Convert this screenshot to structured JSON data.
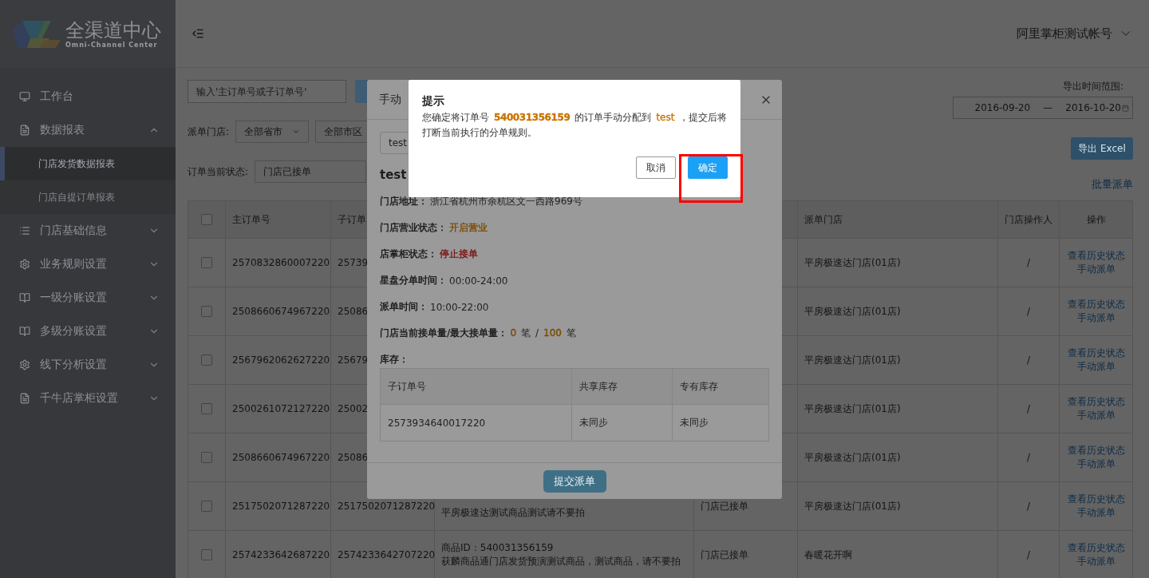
{
  "logo": {
    "title": "全渠道中心",
    "subtitle": "Omni-Channel Center"
  },
  "sidebar": {
    "items": [
      {
        "label": "工作台"
      },
      {
        "label": "数据报表",
        "expanded": true,
        "children": [
          {
            "label": "门店发货数据报表",
            "selected": true
          },
          {
            "label": "门店自提订单报表",
            "selected": false
          }
        ]
      },
      {
        "label": "门店基础信息",
        "expanded": false
      },
      {
        "label": "业务规则设置",
        "expanded": false
      },
      {
        "label": "一级分账设置",
        "expanded": false
      },
      {
        "label": "多级分账设置",
        "expanded": false
      },
      {
        "label": "线下分析设置",
        "expanded": false
      },
      {
        "label": "千牛店掌柜设置",
        "expanded": false
      }
    ]
  },
  "header": {
    "account": "阿里掌柜测试帐号"
  },
  "filters": {
    "search_placeholder": "输入'主订单号或子订单号'",
    "store_label": "派单门店:",
    "province": "全部省市",
    "district": "全部市区",
    "status_label": "订单当前状态:",
    "status": "门店已接单"
  },
  "export": {
    "range_label": "导出时间范围:",
    "start": "2016-09-20",
    "separator": "—",
    "end": "2016-10-20",
    "button": "导出 Excel",
    "batch_link": "批量派单"
  },
  "table": {
    "select_all_checked": false,
    "columns": {
      "main_order": "主订单号",
      "sub_order": "子订单",
      "store": "派单门店",
      "operator": "门店操作人",
      "actions": "操作"
    },
    "rows": [
      {
        "checked": false,
        "main_order": "2570832860007220",
        "sub_order": "25739",
        "store": "平房极速达门店(01店)",
        "operator": "/",
        "actions": [
          "查看历史状态",
          "手动派单"
        ]
      },
      {
        "checked": false,
        "main_order": "2508660674967220",
        "sub_order": "25086",
        "store": "平房极速达门店(01店)",
        "operator": "/",
        "actions": [
          "查看历史状态",
          "手动派单"
        ]
      },
      {
        "checked": false,
        "main_order": "2567962062627220",
        "sub_order": "25679",
        "store": "平房极速达门店(01店)",
        "operator": "/",
        "actions": [
          "查看历史状态",
          "手动派单"
        ]
      },
      {
        "checked": false,
        "main_order": "2500261072127220",
        "sub_order": "25002",
        "store": "平房极速达门店(01店)",
        "operator": "/",
        "actions": [
          "查看历史状态",
          "手动派单"
        ]
      },
      {
        "checked": false,
        "main_order": "2508660674967220",
        "sub_order": "25086",
        "store": "平房极速达门店(01店)",
        "operator": "/",
        "actions": [
          "查看历史状态",
          "手动派单"
        ]
      },
      {
        "checked": false,
        "main_order": "2517502071287220",
        "sub_order": "2517502071287220",
        "product": [
          "平房极速达测试商品测试请不要拍"
        ],
        "status": "门店已接单",
        "store": "平房极速达门店(01店)",
        "operator": "/",
        "actions": [
          "查看历史状态",
          "手动派单"
        ]
      },
      {
        "checked": false,
        "main_order": "2574233642687220",
        "sub_order": "2574233642707220",
        "product": [
          "商品ID：540031356159",
          "获麟商品通门店发货预演测试商品，测试商品，请不要拍"
        ],
        "status": "门店已接单",
        "store": "春暖花开啊",
        "operator": "/",
        "actions": [
          "查看历史状态",
          "手动派单"
        ]
      }
    ]
  },
  "dispatch_modal": {
    "title": "手动",
    "store_select": "test",
    "store_name": "test",
    "info": [
      {
        "label": "门店地址：",
        "parts": [
          {
            "text": "浙江省杭州市余杭区文一西路969号"
          }
        ]
      },
      {
        "label": "门店营业状态：",
        "parts": [
          {
            "text": "开启营业",
            "color": "#7a4a00"
          }
        ]
      },
      {
        "label": "店掌柜状态：",
        "parts": [
          {
            "text": "停止接单",
            "color": "#7a1010"
          }
        ]
      },
      {
        "label": "星盘分单时间：",
        "parts": [
          {
            "text": "00:00-24:00"
          }
        ]
      },
      {
        "label": "派单时间：",
        "parts": [
          {
            "text": "10:00-22:00"
          }
        ]
      },
      {
        "label": "门店当前接单量/最大接单量：",
        "parts": [
          {
            "text": "0",
            "color": "#7a4a00"
          },
          {
            "text": "笔"
          },
          {
            "text": "/"
          },
          {
            "text": "100",
            "color": "#7a4a00"
          },
          {
            "text": "笔"
          }
        ]
      }
    ],
    "stock_label": "库存：",
    "stock_columns": [
      "子订单号",
      "共享库存",
      "专有库存"
    ],
    "stock_rows": [
      [
        "2573934640017220",
        "未同步",
        "未同步"
      ]
    ],
    "submit": "提交派单"
  },
  "confirm_dialog": {
    "title": "提示",
    "message": [
      {
        "text": "您确定将订单号"
      },
      {
        "text": "540031356159",
        "color": "#c97400",
        "bold": true
      },
      {
        "text": "的订单手动分配到"
      },
      {
        "text": "test",
        "color": "#c97400"
      },
      {
        "text": "，提交后将打断当前执行的分单规则。"
      }
    ],
    "cancel": "取消",
    "ok": "确定"
  },
  "annotation": {
    "kind": "highlight-box"
  }
}
